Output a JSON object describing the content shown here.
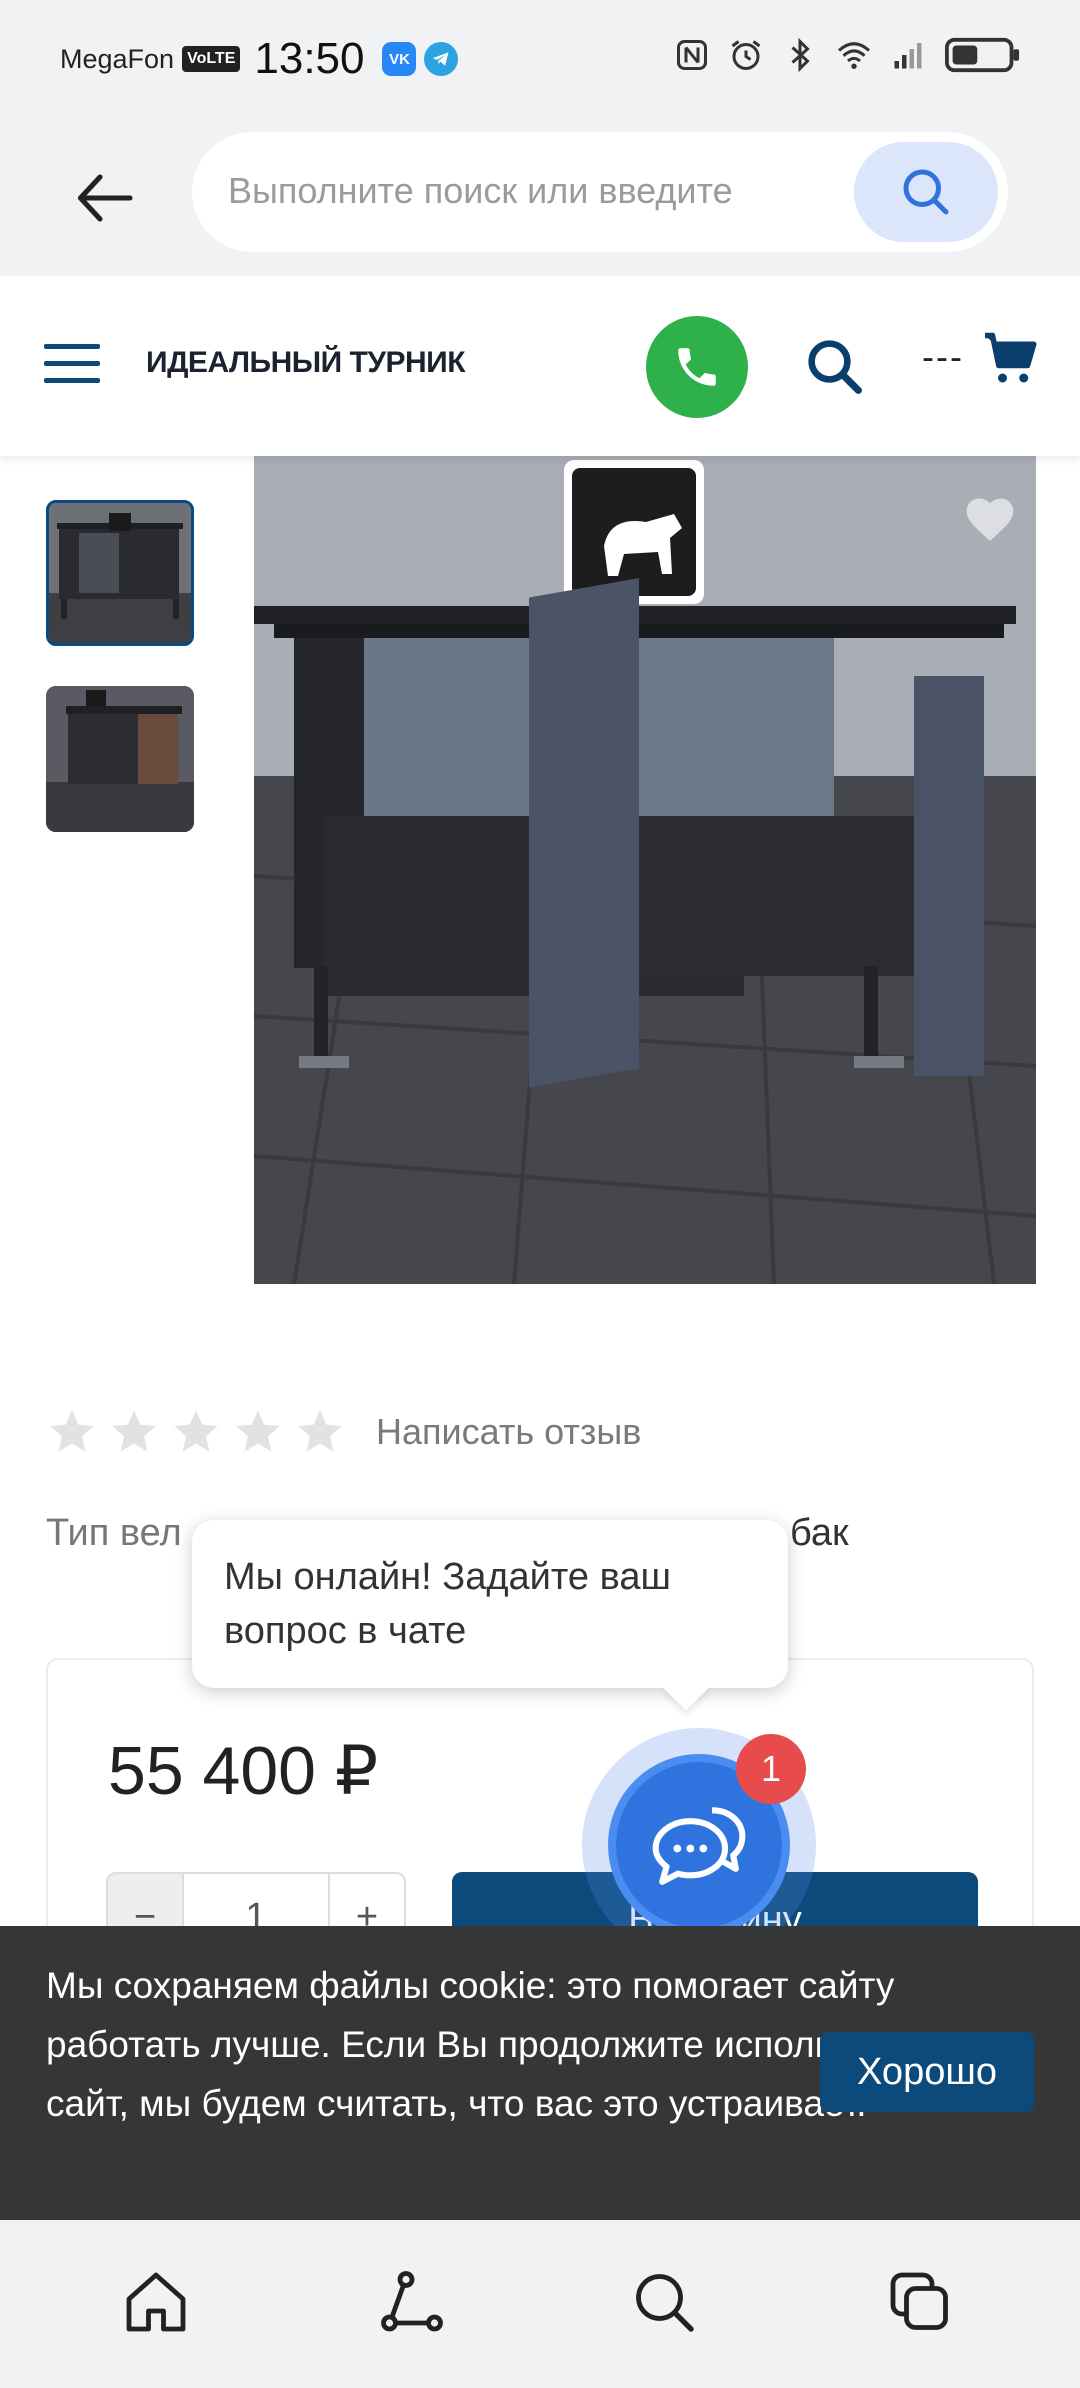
{
  "status_bar": {
    "carrier": "MegaFon",
    "volte": "VoLTE",
    "time": "13:50",
    "vk_badge": "VK"
  },
  "browser": {
    "url_placeholder": "Выполните поиск или введите"
  },
  "header": {
    "site_title": "ИДЕАЛЬНЫЙ ТУРНИК",
    "cart_count": "---"
  },
  "product": {
    "review_link": "Написать отзыв",
    "rating_stars": 0,
    "property_label": "Тип вел",
    "property_value": "бак",
    "price": "55 400 ₽",
    "quantity": "1",
    "qty_minus": "−",
    "qty_plus": "+",
    "add_to_cart": "В корзину"
  },
  "chat": {
    "tooltip": "Мы онлайн! Задайте ваш вопрос в чате",
    "badge_count": "1"
  },
  "cookie": {
    "text": "Мы сохраняем файлы cookie: это помогает сайту работать лучше. Если Вы продолжите использовать сайт, мы будем считать, что вас это устраивает.",
    "button": "Хорошо"
  },
  "colors": {
    "brand": "#0b4a7a",
    "phone_green": "#2eb14b",
    "chat_blue": "#2f74de",
    "badge_red": "#e84b4b",
    "cookie_bg": "#343638"
  },
  "icons": {
    "back": "arrow-left-icon",
    "search": "search-icon",
    "menu": "hamburger-icon",
    "phone": "phone-icon",
    "cart": "cart-icon",
    "heart": "heart-icon",
    "star": "star-icon",
    "chat": "chat-bubbles-icon",
    "home": "home-icon",
    "share": "share-icon",
    "tabs": "tabs-icon"
  }
}
